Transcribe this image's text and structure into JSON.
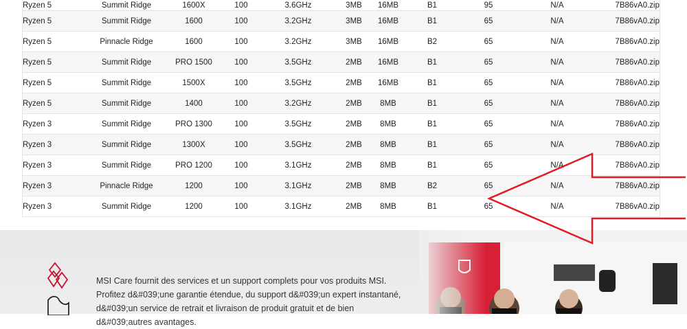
{
  "table": {
    "rows": [
      {
        "family": "Ryzen 5",
        "codename": "Summit Ridge",
        "model": "1600X",
        "bus": "100",
        "freq": "3.6GHz",
        "l2": "3MB",
        "l3": "16MB",
        "stepping": "B1",
        "tdp": "95",
        "na": "N/A",
        "file": "7B86vA0.zip"
      },
      {
        "family": "Ryzen 5",
        "codename": "Summit Ridge",
        "model": "1600",
        "bus": "100",
        "freq": "3.2GHz",
        "l2": "3MB",
        "l3": "16MB",
        "stepping": "B1",
        "tdp": "65",
        "na": "N/A",
        "file": "7B86vA0.zip"
      },
      {
        "family": "Ryzen 5",
        "codename": "Pinnacle Ridge",
        "model": "1600",
        "bus": "100",
        "freq": "3.2GHz",
        "l2": "3MB",
        "l3": "16MB",
        "stepping": "B2",
        "tdp": "65",
        "na": "N/A",
        "file": "7B86vA0.zip"
      },
      {
        "family": "Ryzen 5",
        "codename": "Summit Ridge",
        "model": "PRO 1500",
        "bus": "100",
        "freq": "3.5GHz",
        "l2": "2MB",
        "l3": "16MB",
        "stepping": "B1",
        "tdp": "65",
        "na": "N/A",
        "file": "7B86vA0.zip"
      },
      {
        "family": "Ryzen 5",
        "codename": "Summit Ridge",
        "model": "1500X",
        "bus": "100",
        "freq": "3.5GHz",
        "l2": "2MB",
        "l3": "16MB",
        "stepping": "B1",
        "tdp": "65",
        "na": "N/A",
        "file": "7B86vA0.zip"
      },
      {
        "family": "Ryzen 5",
        "codename": "Summit Ridge",
        "model": "1400",
        "bus": "100",
        "freq": "3.2GHz",
        "l2": "2MB",
        "l3": "8MB",
        "stepping": "B1",
        "tdp": "65",
        "na": "N/A",
        "file": "7B86vA0.zip"
      },
      {
        "family": "Ryzen 3",
        "codename": "Summit Ridge",
        "model": "PRO 1300",
        "bus": "100",
        "freq": "3.5GHz",
        "l2": "2MB",
        "l3": "8MB",
        "stepping": "B1",
        "tdp": "65",
        "na": "N/A",
        "file": "7B86vA0.zip"
      },
      {
        "family": "Ryzen 3",
        "codename": "Summit Ridge",
        "model": "1300X",
        "bus": "100",
        "freq": "3.5GHz",
        "l2": "2MB",
        "l3": "8MB",
        "stepping": "B1",
        "tdp": "65",
        "na": "N/A",
        "file": "7B86vA0.zip"
      },
      {
        "family": "Ryzen 3",
        "codename": "Summit Ridge",
        "model": "PRO 1200",
        "bus": "100",
        "freq": "3.1GHz",
        "l2": "2MB",
        "l3": "8MB",
        "stepping": "B1",
        "tdp": "65",
        "na": "N/A",
        "file": "7B86vA0.zip"
      },
      {
        "family": "Ryzen 3",
        "codename": "Pinnacle Ridge",
        "model": "1200",
        "bus": "100",
        "freq": "3.1GHz",
        "l2": "2MB",
        "l3": "8MB",
        "stepping": "B2",
        "tdp": "65",
        "na": "N/A",
        "file": "7B86vA0.zip"
      },
      {
        "family": "Ryzen 3",
        "codename": "Summit Ridge",
        "model": "1200",
        "bus": "100",
        "freq": "3.1GHz",
        "l2": "2MB",
        "l3": "8MB",
        "stepping": "B1",
        "tdp": "65",
        "na": "N/A",
        "file": "7B86vA0.zip"
      }
    ]
  },
  "footer": {
    "care_text": "MSI Care fournit des services et un support complets pour vos produits MSI. Profitez d&#039;une garantie étendue, du support d&#039;un expert instantané, d&#039;un service de retrait et livraison de produit gratuit et de bien d&#039;autres avantages.",
    "logo_icon": "msi-care-heart-hand-icon",
    "promo_image": "msi-staff-photo",
    "annotation": "red-arrow-pointer"
  },
  "colors": {
    "arrow": "#e01b24",
    "banner_red": "#d71f36"
  }
}
